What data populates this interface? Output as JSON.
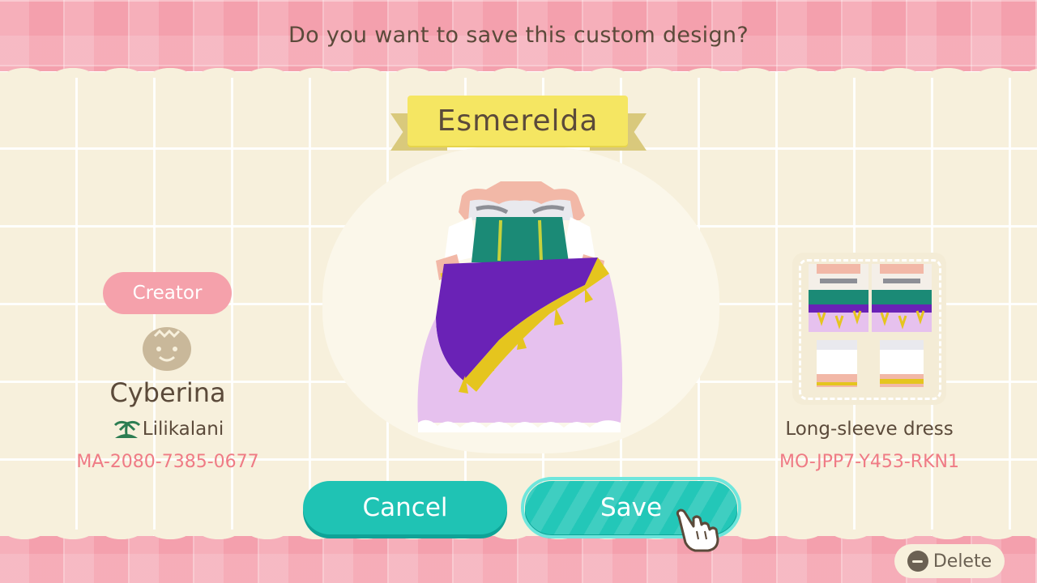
{
  "dialog": {
    "prompt": "Do you want to save this custom design?",
    "design_name": "Esmerelda"
  },
  "creator": {
    "label": "Creator",
    "name": "Cyberina",
    "island": "Lilikalani",
    "code": "MA-2080-7385-0677",
    "avatar_icon": "villager-face-icon",
    "island_icon": "palm-tree-icon"
  },
  "design": {
    "item_type": "Long-sleeve dress",
    "code": "MO-JPP7-Y453-RKN1",
    "preview": "dress-preview",
    "pattern_thumbnail": "pattern-layout"
  },
  "buttons": {
    "cancel": "Cancel",
    "save": "Save",
    "delete": "Delete"
  },
  "colors": {
    "accent": "#1fc3b4",
    "pink": "#f5a1ab",
    "code_text": "#ef7b85",
    "ribbon": "#f5e662"
  }
}
